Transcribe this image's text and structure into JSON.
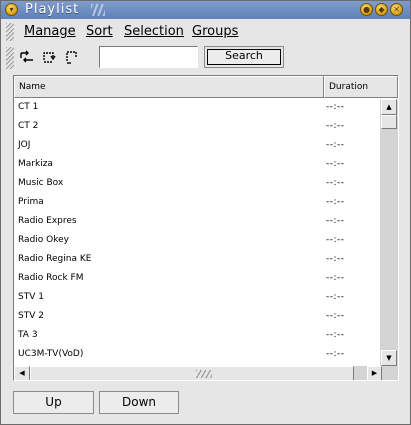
{
  "window": {
    "title": "Playlist",
    "controls": [
      "shade-icon",
      "maximize-icon",
      "close-icon"
    ]
  },
  "menu": {
    "items": [
      {
        "label": "Manage"
      },
      {
        "label": "Sort"
      },
      {
        "label": "Selection"
      },
      {
        "label": "Groups"
      }
    ]
  },
  "toolbar": {
    "icons": [
      "shuffle-icon",
      "loop-icon",
      "repeat-one-icon"
    ],
    "search_value": "",
    "search_label": "Search"
  },
  "list": {
    "columns": [
      "Name",
      "Duration"
    ],
    "rows": [
      {
        "name": "CT 1",
        "duration": "--:--"
      },
      {
        "name": "CT 2",
        "duration": "--:--"
      },
      {
        "name": "JOJ",
        "duration": "--:--"
      },
      {
        "name": "Markiza",
        "duration": "--:--"
      },
      {
        "name": "Music Box",
        "duration": "--:--"
      },
      {
        "name": "Prima",
        "duration": "--:--"
      },
      {
        "name": "Radio Expres",
        "duration": "--:--"
      },
      {
        "name": "Radio Okey",
        "duration": "--:--"
      },
      {
        "name": "Radio Regina KE",
        "duration": "--:--"
      },
      {
        "name": "Radio Rock FM",
        "duration": "--:--"
      },
      {
        "name": "STV 1",
        "duration": "--:--"
      },
      {
        "name": "STV 2",
        "duration": "--:--"
      },
      {
        "name": "TA 3",
        "duration": "--:--"
      },
      {
        "name": "UC3M-TV(VoD)",
        "duration": "--:--"
      }
    ]
  },
  "buttons": {
    "up": "Up",
    "down": "Down"
  },
  "colors": {
    "titlebar": "#6b8cc2",
    "window_bg": "#e6e6e6",
    "list_bg": "#ffffff"
  }
}
